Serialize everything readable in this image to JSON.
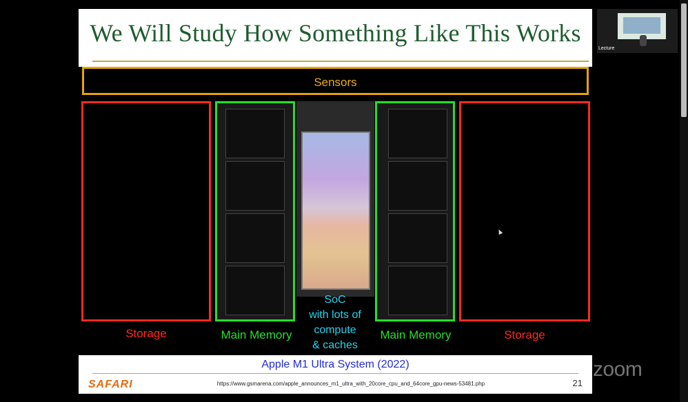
{
  "slide": {
    "title": "We Will Study How Something Like This Works",
    "sensors_label": "Sensors",
    "storage_left_label": "Storage",
    "storage_right_label": "Storage",
    "memory_left_label": "Main Memory",
    "memory_right_label": "Main Memory",
    "soc_label_lines": [
      "SoC",
      "with lots of",
      "compute",
      "& caches"
    ],
    "caption": "Apple M1 Ultra System (2022)",
    "logo_text": "SAFARI",
    "source_url": "https://www.gsmarena.com/apple_announces_m1_ultra_with_20core_cpu_and_64core_gpu-news-53481.php",
    "page_number": "21"
  },
  "thumbnail": {
    "label": "Lecture"
  },
  "watermark": "zoom",
  "colors": {
    "title_green": "#1f5c2e",
    "sensors_border": "#e8a400",
    "storage_red": "#ff2a1a",
    "memory_green": "#22e02a",
    "soc_cyan": "#22d6ee",
    "caption_blue": "#1f2bd8",
    "safari_orange": "#e86a10"
  }
}
